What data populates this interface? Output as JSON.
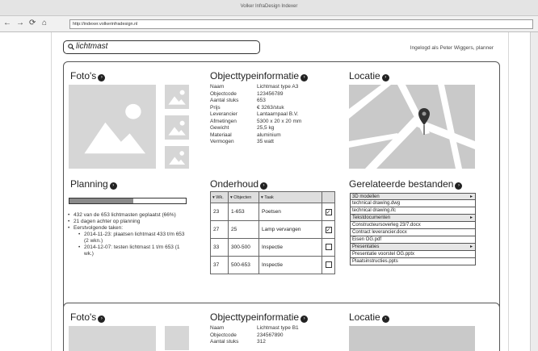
{
  "browser": {
    "title": "Volker InfraDesign Indexer",
    "url": "http://indexer.volkerinfradesign.nl"
  },
  "search": {
    "value": "lichtmast"
  },
  "user": {
    "logged_in_text": "Ingelogd als Peter Wiggers, planner"
  },
  "card1": {
    "photos": {
      "title": "Foto's"
    },
    "objectinfo": {
      "title": "Objecttypeinformatie",
      "fields": [
        {
          "key": "Naam",
          "value": "Lichtmast type A3"
        },
        {
          "key": "Objectcode",
          "value": "123456789"
        },
        {
          "key": "Aantal stuks",
          "value": "653"
        },
        {
          "key": "Prijs",
          "value": "€ 3263/stuk"
        },
        {
          "key": "Leverancier",
          "value": "Lantaarnpaal B.V."
        },
        {
          "key": "Afmetingen",
          "value": "5300 x 20 x 20 mm"
        },
        {
          "key": "Gewicht",
          "value": "25,5 kg"
        },
        {
          "key": "Materiaal",
          "value": "aluminium"
        },
        {
          "key": "Vermogen",
          "value": "35 watt"
        }
      ]
    },
    "location": {
      "title": "Locatie"
    },
    "planning": {
      "title": "Planning",
      "progress": 0.55,
      "items": [
        "432 van de 653 lichtmasten geplaatst (66%)",
        "21 dagen achter op planning",
        "Eerstvolgende taken:"
      ],
      "subitems": [
        "2014-11-23: plaatsen lichtmast 433 t/m 653 (2 wkn.)",
        "2014-12-07: testen lichtmast 1 t/m 653 (1 wk.)"
      ]
    },
    "maintenance": {
      "title": "Onderhoud",
      "headers": [
        "▾ Wk.",
        "▾ Objecten",
        "▾ Taak"
      ],
      "rows": [
        {
          "wk": "23",
          "objects": "1-653",
          "task": "Poetsen",
          "checked": true
        },
        {
          "wk": "27",
          "objects": "25",
          "task": "Lamp vervangen",
          "checked": true
        },
        {
          "wk": "33",
          "objects": "300-500",
          "task": "Inspectie",
          "checked": false
        },
        {
          "wk": "37",
          "objects": "500-653",
          "task": "Inspectie",
          "checked": false
        }
      ]
    },
    "files": {
      "title": "Gerelateerde bestanden",
      "items": [
        {
          "label": "3D modellen",
          "group": true
        },
        {
          "label": "technical drawing.dwg",
          "group": false
        },
        {
          "label": "technical drawing.ifc",
          "group": false
        },
        {
          "label": "Tekstdocumenten",
          "group": true
        },
        {
          "label": "Constructeursoverleg 23/7.docx",
          "group": false
        },
        {
          "label": "Contract leverancier.docx",
          "group": false
        },
        {
          "label": "Eisen OG.pdf",
          "group": false
        },
        {
          "label": "Presentaties",
          "group": true
        },
        {
          "label": "Presentatie voorstel OG.pptx",
          "group": false
        },
        {
          "label": "Plaatsinstructies.ppts",
          "group": false
        }
      ]
    }
  },
  "card2": {
    "photos": {
      "title": "Foto's"
    },
    "objectinfo": {
      "title": "Objecttypeinformatie",
      "fields": [
        {
          "key": "Naam",
          "value": "Lichtmast type B1"
        },
        {
          "key": "Objectcode",
          "value": "234567890"
        },
        {
          "key": "Aantal stuks",
          "value": "312"
        }
      ]
    },
    "location": {
      "title": "Locatie"
    }
  }
}
